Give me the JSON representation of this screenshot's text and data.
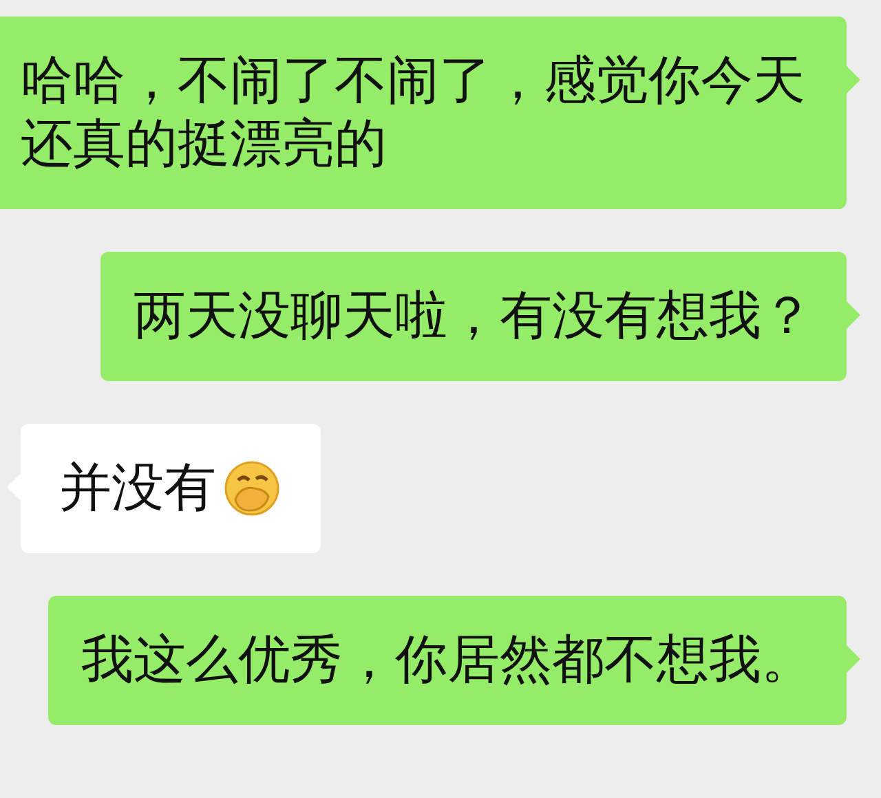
{
  "messages": [
    {
      "kind": "sent",
      "text": "哈哈，不闹了不闹了，感觉你今天还真的挺漂亮的"
    },
    {
      "kind": "sent",
      "text": "两天没聊天啦，有没有想我？"
    },
    {
      "kind": "received",
      "text": "并没有",
      "emoji": true
    },
    {
      "kind": "sent",
      "text": "我这么优秀，你居然都不想我。"
    }
  ]
}
